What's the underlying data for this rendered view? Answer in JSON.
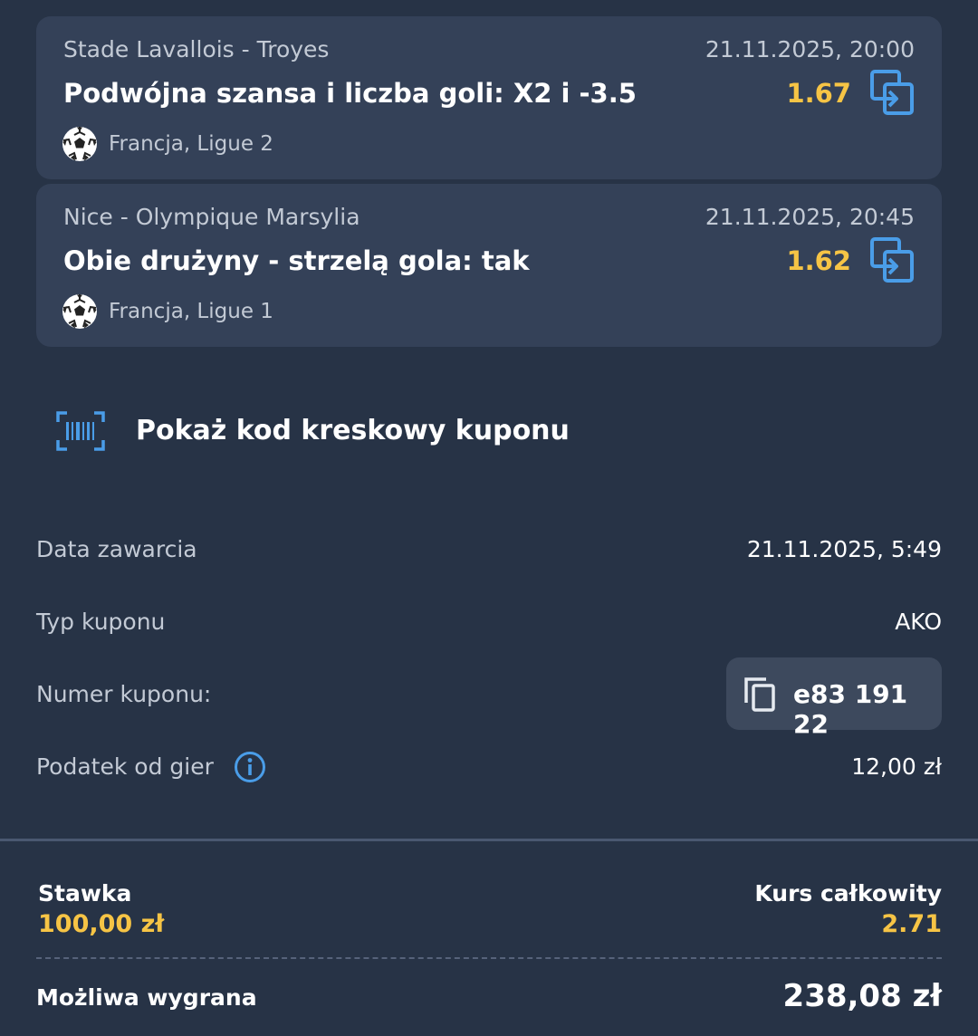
{
  "bets": [
    {
      "match": "Stade Lavallois - Troyes",
      "date": "21.11.2025, 20:00",
      "market": "Podwójna szansa i liczba goli: X2 i -3.5",
      "odds": "1.67",
      "league": "Francja, Ligue 2",
      "sport_icon": "soccer-ball-icon",
      "action_icon": "copy-to-slip-icon"
    },
    {
      "match": "Nice - Olympique Marsylia",
      "date": "21.11.2025, 20:45",
      "market": "Obie drużyny - strzelą gola: tak",
      "odds": "1.62",
      "league": "Francja, Ligue 1",
      "sport_icon": "soccer-ball-icon",
      "action_icon": "copy-to-slip-icon"
    }
  ],
  "barcode": {
    "label": "Pokaż kod kreskowy kuponu",
    "icon": "barcode-scan-icon"
  },
  "details": {
    "date_label": "Data zawarcia",
    "date_value": "21.11.2025, 5:49",
    "type_label": "Typ kuponu",
    "type_value": "AKO",
    "number_label": "Numer kuponu:",
    "number_value": "e83 191 22",
    "tax_label": "Podatek od gier",
    "tax_value": "12,00 zł"
  },
  "summary": {
    "stake_label": "Stawka",
    "stake_value": "100,00 zł",
    "total_odds_label": "Kurs całkowity",
    "total_odds_value": "2.71",
    "win_label": "Możliwa wygrana",
    "win_value": "238,08 zł"
  },
  "colors": {
    "background": "#273346",
    "card": "#344158",
    "accent_yellow": "#f6c445",
    "accent_blue": "#4a9de8"
  }
}
